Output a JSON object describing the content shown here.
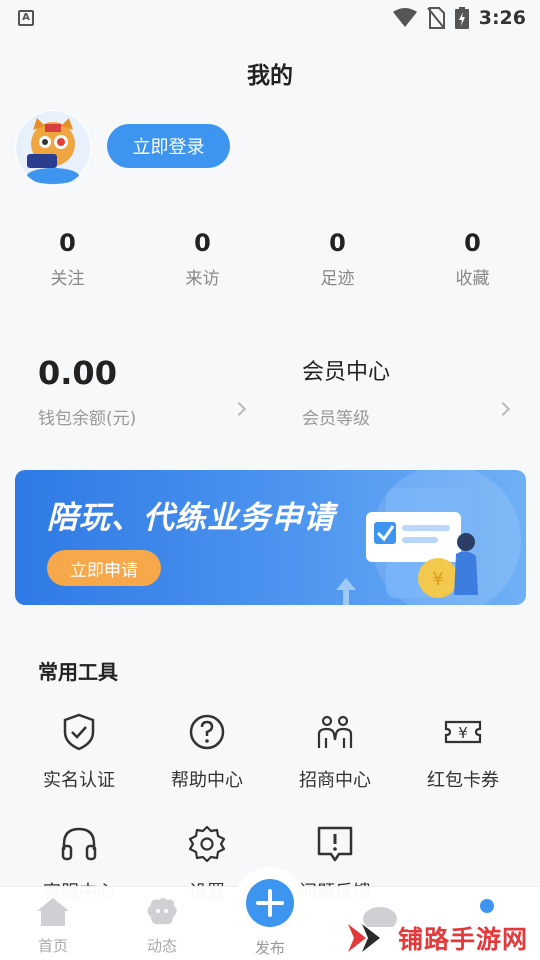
{
  "status_bar": {
    "notif_letter": "A",
    "time": "3:26",
    "icons": [
      "wifi-icon",
      "no-sim-icon",
      "battery-charging-icon"
    ]
  },
  "header": {
    "title": "我的"
  },
  "profile": {
    "avatar_icon": "tiger-mascot-avatar",
    "login_label": "立即登录"
  },
  "stats": [
    {
      "value": "0",
      "label": "关注"
    },
    {
      "value": "0",
      "label": "来访"
    },
    {
      "value": "0",
      "label": "足迹"
    },
    {
      "value": "0",
      "label": "收藏"
    }
  ],
  "wallet": {
    "balance": "0.00",
    "balance_label": "钱包余额(元)",
    "member_title": "会员中心",
    "member_label": "会员等级"
  },
  "banner": {
    "title": "陪玩、代练业务申请",
    "button_label": "立即申请"
  },
  "tools": {
    "section_title": "常用工具",
    "items": [
      {
        "label": "实名认证",
        "icon": "shield-check-icon"
      },
      {
        "label": "帮助中心",
        "icon": "help-circle-icon"
      },
      {
        "label": "招商中心",
        "icon": "people-icon"
      },
      {
        "label": "红包卡券",
        "icon": "coupon-icon"
      },
      {
        "label": "客服中心",
        "icon": "headset-icon"
      },
      {
        "label": "设置",
        "icon": "gear-icon"
      },
      {
        "label": "问题反馈",
        "icon": "feedback-icon"
      }
    ]
  },
  "bottom_nav": {
    "items": [
      {
        "label": "首页",
        "icon": "home-icon"
      },
      {
        "label": "动态",
        "icon": "dynamic-icon"
      },
      {
        "label": "发布",
        "icon": "plus-icon"
      }
    ]
  },
  "watermark": {
    "text": "铺路手游网"
  },
  "colors": {
    "accent": "#3d95f0",
    "banner_button": "#f6a84a",
    "watermark": "#e23a3a"
  }
}
